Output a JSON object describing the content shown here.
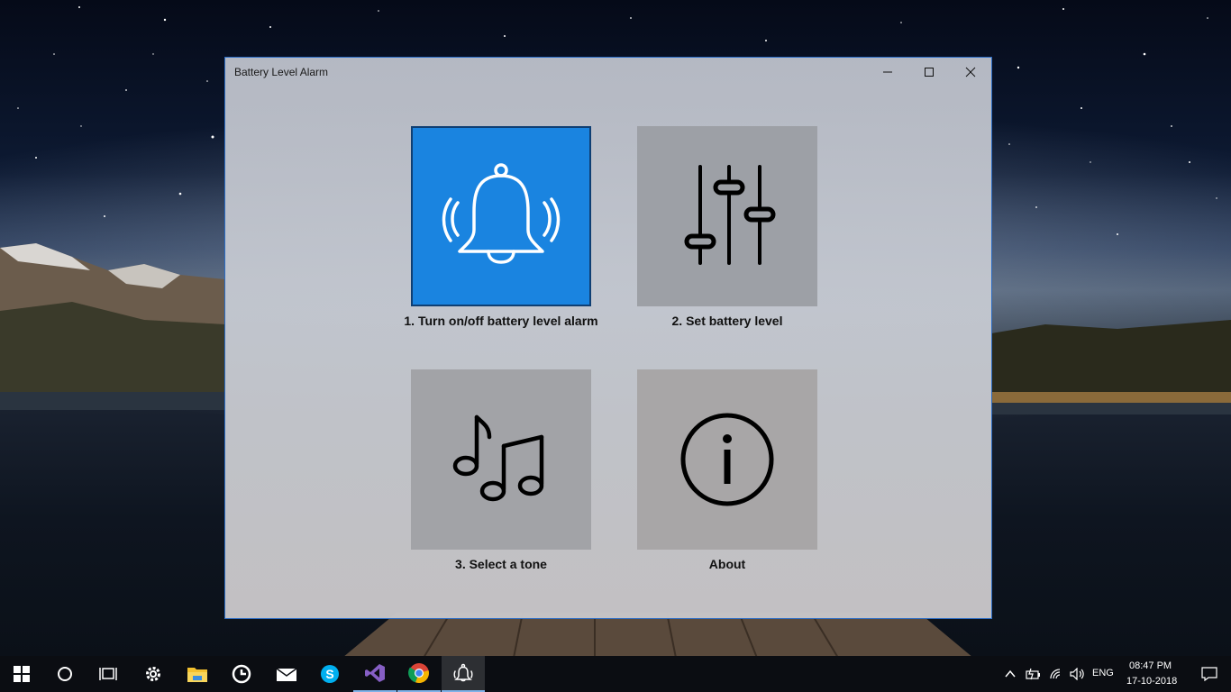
{
  "window": {
    "title": "Battery Level Alarm"
  },
  "tiles": [
    {
      "label": "1. Turn on/off battery level alarm",
      "icon": "bell-icon",
      "selected": true,
      "color": "#1a84e0"
    },
    {
      "label": "2. Set battery level",
      "icon": "sliders-icon",
      "selected": false
    },
    {
      "label": "3. Select a tone",
      "icon": "music-notes-icon",
      "selected": false
    },
    {
      "label": "About",
      "icon": "info-icon",
      "selected": false
    }
  ],
  "taskbar": {
    "items": [
      "windows-start-icon",
      "cortana-icon",
      "task-view-icon",
      "settings-icon",
      "file-explorer-icon",
      "app-icon",
      "mail-icon",
      "skype-icon",
      "visual-studio-icon",
      "chrome-icon",
      "battery-alarm-icon"
    ],
    "tray": {
      "language": "ENG",
      "time": "08:47 PM",
      "date": "17-10-2018"
    }
  },
  "colors": {
    "accent": "#1a84e0",
    "tile_gray": "#9b9ea4",
    "window_border": "#2b6cc4"
  }
}
